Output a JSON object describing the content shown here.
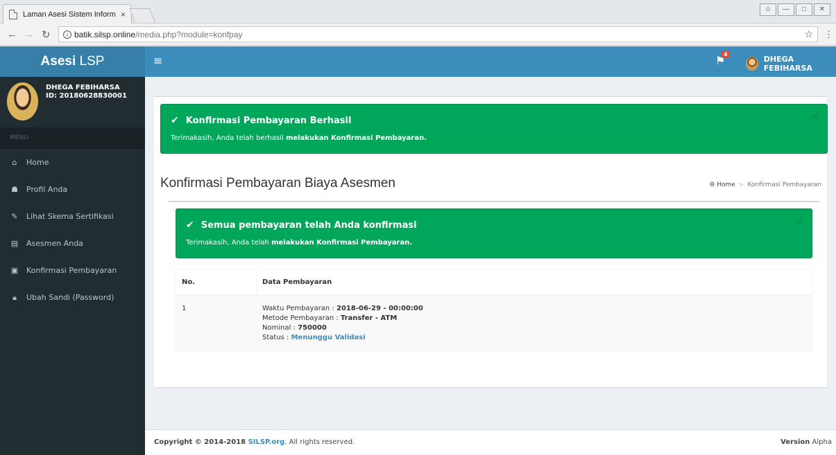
{
  "browser": {
    "tab_title": "Laman Asesi Sistem Inform",
    "tab_close": "×",
    "url_host": "batik.silsp.online",
    "url_path": "/media.php?module=konfpay"
  },
  "header": {
    "logo_bold": "Asesi",
    "logo_rest": " LSP",
    "menu_toggle": "≡",
    "notif_count": "4",
    "user_name": "DHEGA FEBIHARSA"
  },
  "sidebar": {
    "user_name": "DHEGA FEBIHARSA",
    "user_id": "ID: 20180628830001",
    "menu_header": "MENU",
    "items": [
      {
        "icon": "home-icon",
        "glyph": "⌂",
        "label": "Home"
      },
      {
        "icon": "user-icon",
        "glyph": "☗",
        "label": "Profil Anda"
      },
      {
        "icon": "edit-icon",
        "glyph": "✎",
        "label": "Lihat Skema Sertifikasi"
      },
      {
        "icon": "file-icon",
        "glyph": "▤",
        "label": "Asesmen Anda"
      },
      {
        "icon": "money-icon",
        "glyph": "▣",
        "label": "Konfirmasi Pembayaran"
      },
      {
        "icon": "lock-icon",
        "glyph": "🔒︎",
        "label": "Ubah Sandi (Password)"
      }
    ]
  },
  "alert_top": {
    "title": "Konfirmasi Pembayaran Berhasil",
    "text_plain": "Terimakasih, Anda telah berhasil ",
    "text_bold": "melakukan Konfirmasi Pembayaran.",
    "close": "×"
  },
  "page": {
    "title": "Konfirmasi Pembayaran Biaya Asesmen",
    "breadcrumb_home": "Home",
    "breadcrumb_sep": ">",
    "breadcrumb_current": "Konfirmasi Pembayaran"
  },
  "alert_inner": {
    "title": "Semua pembayaran telah Anda konfirmasi",
    "text_plain": "Terimakasih, Anda telah ",
    "text_bold": "melakukan Konfirmasi Pembayaran.",
    "close": "×"
  },
  "table": {
    "col_no": "No.",
    "col_data": "Data Pembayaran",
    "row": {
      "no": "1",
      "waktu_label": "Waktu Pembayaran : ",
      "waktu_value": "2018-06-29 - 00:00:00",
      "metode_label": "Metode Pembayaran : ",
      "metode_value": "Transfer - ATM",
      "nominal_label": "Nominal : ",
      "nominal_value": "750000",
      "status_label": "Status : ",
      "status_value": "Menunggu Validasi"
    }
  },
  "footer": {
    "copyright_prefix": "Copyright © 2014-2018 ",
    "brand": "SILSP.org",
    "copyright_suffix": ". All rights reserved.",
    "version_label": "Version",
    "version_value": " Alpha"
  },
  "colors": {
    "topnav": "#3c8dbc",
    "logo": "#367fa9",
    "sidebar": "#222d32",
    "success": "#00a65a",
    "link": "#3c8dbc"
  }
}
